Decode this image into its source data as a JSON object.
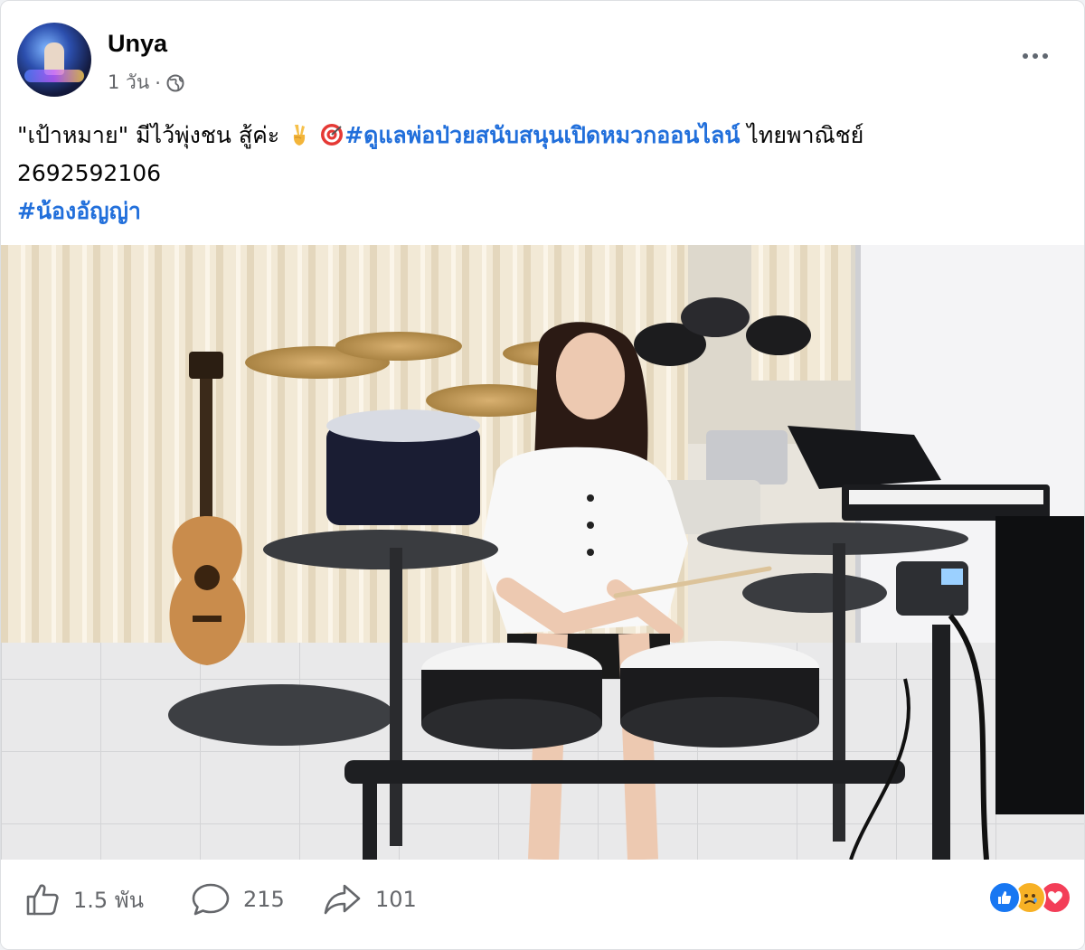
{
  "post": {
    "author": "Unya",
    "time": "1 วัน",
    "time_separator": "·",
    "text": {
      "quote": "\"เป้าหมาย\" มีไว้พุ่งชน สู้ค่ะ",
      "hashtag_1": "#ดูแลพ่อป่วยสนับสนุนเปิดหมวกออนไลน์",
      "bank_text": " ไทยพาณิชย์",
      "account_number": "2692592106",
      "hashtag_2": "#น้องอัญญ่า"
    }
  },
  "footer": {
    "like_count": "1.5 พัน",
    "comment_count": "215",
    "share_count": "101"
  },
  "icons": {
    "more": "more-options-icon",
    "privacy": "globe-icon",
    "emoji_1": "victory-hand-emoji",
    "emoji_2": "target-emoji",
    "like": "thumbs-up-icon",
    "comment": "comment-icon",
    "share": "share-icon",
    "reactions": [
      "like-reaction-icon",
      "sad-reaction-icon",
      "love-reaction-icon"
    ]
  },
  "colors": {
    "hashtag": "#216fdb",
    "secondary_text": "#65676b",
    "like_blue": "#1877f2",
    "love_red": "#f33e58",
    "sad_yellow": "#f7b125"
  }
}
